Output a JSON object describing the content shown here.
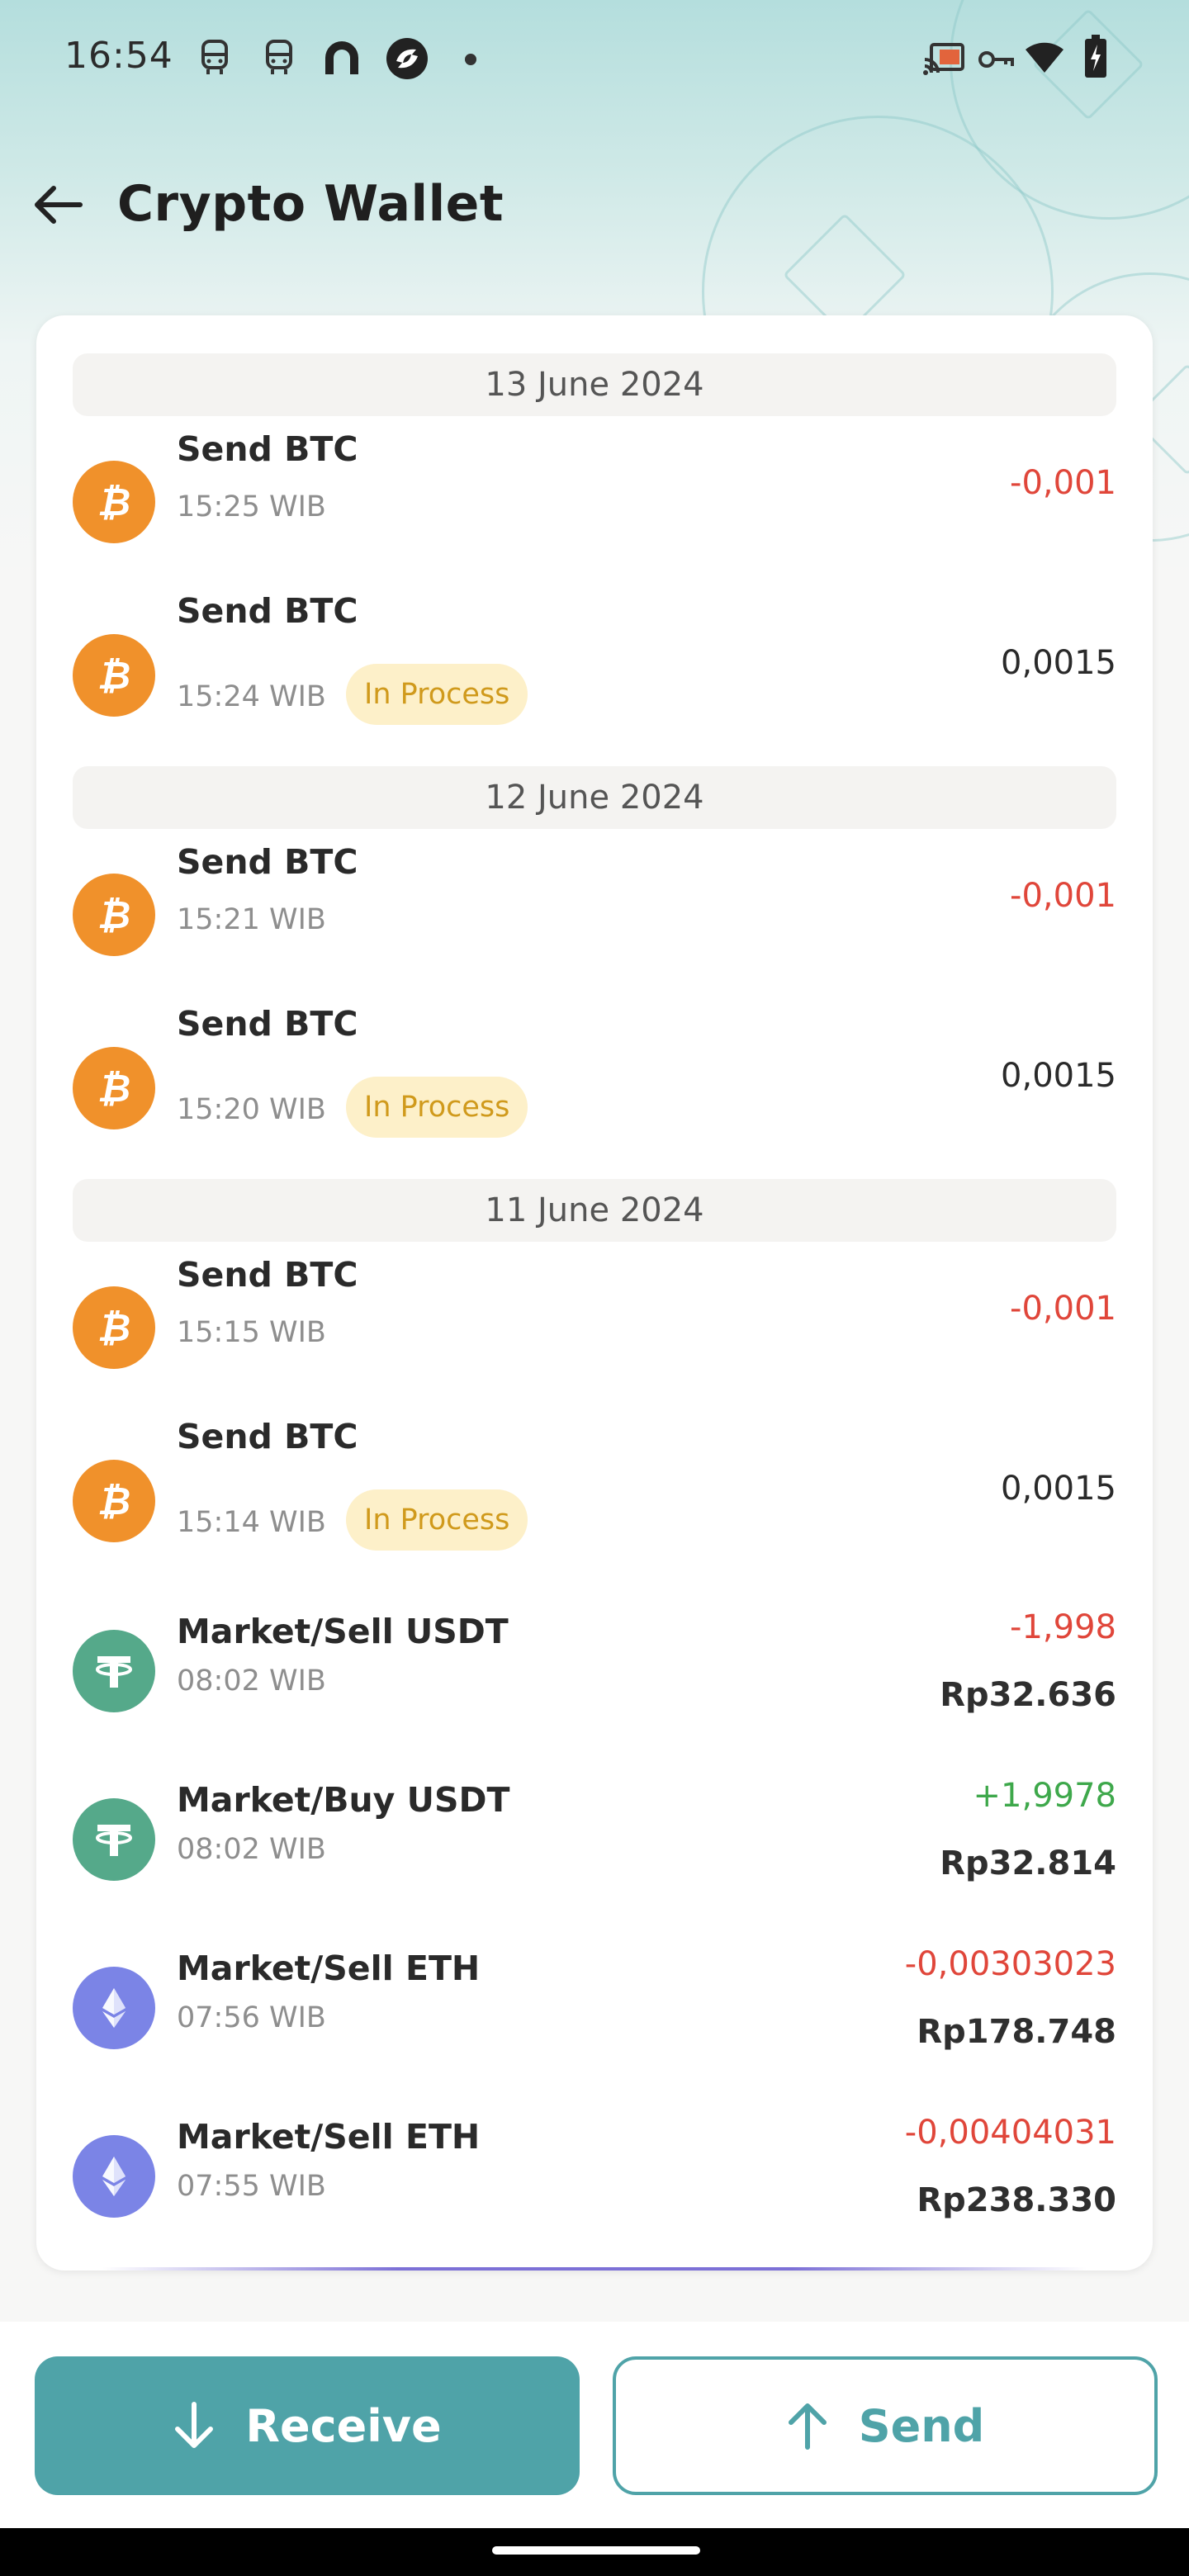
{
  "status_bar": {
    "time": "16:54",
    "notification_icons": [
      "bus-icon",
      "bus-icon",
      "circle-app-icon",
      "circle-app-icon",
      "dot-icon"
    ],
    "system_icons": [
      "cast-icon",
      "vpn-key-icon",
      "wifi-icon",
      "battery-charging-icon"
    ]
  },
  "header": {
    "title": "Crypto Wallet",
    "back_icon": "arrow-left-icon"
  },
  "groups": [
    {
      "date": "13 June 2024",
      "items": [
        {
          "coin": "btc",
          "title": "Send BTC",
          "time": "15:25 WIB",
          "badge": "",
          "amount": "-0,001",
          "amount_type": "neg",
          "fiat": ""
        },
        {
          "coin": "btc",
          "title": "Send BTC",
          "time": "15:24 WIB",
          "badge": "In Process",
          "amount": "0,0015",
          "amount_type": "neutral",
          "fiat": ""
        }
      ]
    },
    {
      "date": "12 June 2024",
      "items": [
        {
          "coin": "btc",
          "title": "Send BTC",
          "time": "15:21 WIB",
          "badge": "",
          "amount": "-0,001",
          "amount_type": "neg",
          "fiat": ""
        },
        {
          "coin": "btc",
          "title": "Send BTC",
          "time": "15:20 WIB",
          "badge": "In Process",
          "amount": "0,0015",
          "amount_type": "neutral",
          "fiat": ""
        }
      ]
    },
    {
      "date": "11 June 2024",
      "items": [
        {
          "coin": "btc",
          "title": "Send BTC",
          "time": "15:15 WIB",
          "badge": "",
          "amount": "-0,001",
          "amount_type": "neg",
          "fiat": ""
        },
        {
          "coin": "btc",
          "title": "Send BTC",
          "time": "15:14 WIB",
          "badge": "In Process",
          "amount": "0,0015",
          "amount_type": "neutral",
          "fiat": ""
        },
        {
          "coin": "usdt",
          "title": "Market/Sell USDT",
          "time": "08:02 WIB",
          "badge": "",
          "amount": "-1,998",
          "amount_type": "neg",
          "fiat": "Rp32.636"
        },
        {
          "coin": "usdt",
          "title": "Market/Buy USDT",
          "time": "08:02 WIB",
          "badge": "",
          "amount": "+1,9978",
          "amount_type": "pos",
          "fiat": "Rp32.814"
        },
        {
          "coin": "eth",
          "title": "Market/Sell ETH",
          "time": "07:56 WIB",
          "badge": "",
          "amount": "-0,00303023",
          "amount_type": "neg",
          "fiat": "Rp178.748"
        },
        {
          "coin": "eth",
          "title": "Market/Sell ETH",
          "time": "07:55 WIB",
          "badge": "",
          "amount": "-0,00404031",
          "amount_type": "neg",
          "fiat": "Rp238.330"
        }
      ]
    }
  ],
  "actions": {
    "receive_label": "Receive",
    "receive_icon": "arrow-down-icon",
    "send_label": "Send",
    "send_icon": "arrow-up-icon"
  },
  "colors": {
    "accent": "#4fa3a8",
    "negative": "#e0463a",
    "positive": "#3ea84b",
    "badge_bg": "#fdf0c9",
    "badge_text": "#d09a1c",
    "btc": "#f0912b",
    "usdt": "#55a98a",
    "eth": "#7b84e6"
  }
}
